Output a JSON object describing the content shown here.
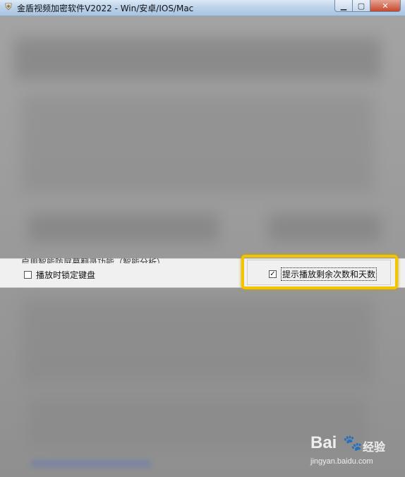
{
  "window": {
    "title": "金盾视频加密软件V2022 - Win/安卓/IOS/Mac",
    "app_icon": "app-shield-icon",
    "buttons": {
      "minimize": "minimize-icon",
      "maximize": "maximize-icon",
      "close": "close-icon"
    }
  },
  "options": {
    "partial_top_label": "启用智能防屏幕翻录功能（智能分析）",
    "lock_keyboard": {
      "label": "播放时锁定键盘",
      "checked": false
    },
    "show_remaining": {
      "label": "提示播放剩余次数和天数",
      "checked": true
    }
  },
  "watermark": {
    "brand": "Bai",
    "brand_cn": "经验",
    "url": "jingyan.baidu.com"
  },
  "colors": {
    "highlight": "#f3c500",
    "titlebar": "#bdd3ea"
  }
}
